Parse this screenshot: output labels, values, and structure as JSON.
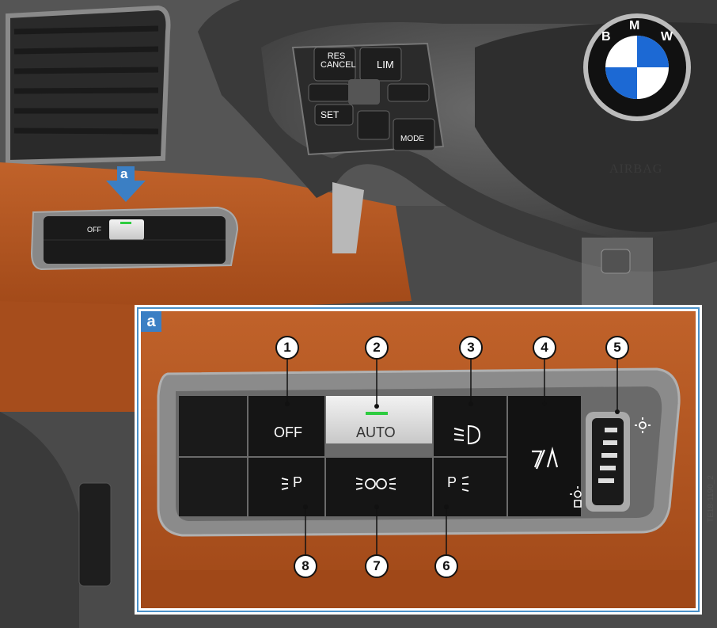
{
  "wheel": {
    "btn_res_cancel_1": "RES",
    "btn_res_cancel_2": "CANCEL",
    "btn_lim": "LIM",
    "btn_set": "SET",
    "btn_mode": "MODE",
    "airbag": "AIRBAG",
    "logo_letters": [
      "B",
      "M",
      "W"
    ]
  },
  "mini_panel": {
    "off": "OFF",
    "icons": [
      "rear-fog-icon",
      "parking-light-icon",
      "low-beam-icon",
      "parking-light-side-icon",
      "front-fog-icon",
      "high-beam-assist-icon"
    ]
  },
  "marker_a": "a",
  "detail": {
    "tag": "a",
    "btn_off": "OFF",
    "btn_auto": "AUTO",
    "auto_indicator_color": "#2ecc40",
    "callouts": [
      "1",
      "2",
      "3",
      "4",
      "5",
      "6",
      "7",
      "8"
    ]
  },
  "image_code": "TE18-1190_2",
  "colors": {
    "leather": "#b5551f",
    "frame_blue": "#4a90c8",
    "arrow_blue": "#3b7fc4",
    "bmw_blue": "#1c69d4"
  }
}
